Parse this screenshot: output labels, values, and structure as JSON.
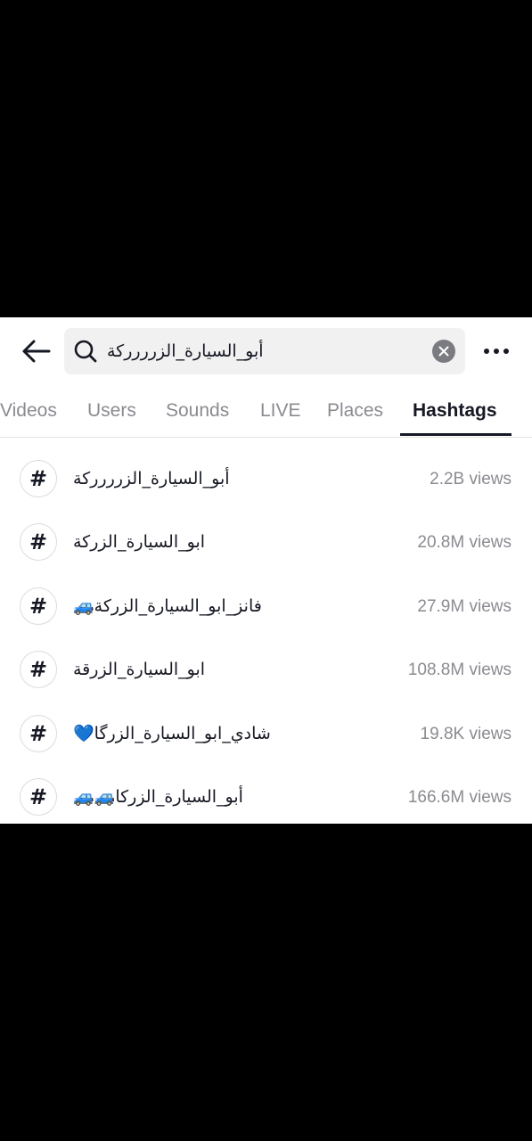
{
  "search": {
    "query": "أبو_السيارة_الزرررركة"
  },
  "tabs": [
    {
      "label": "Videos"
    },
    {
      "label": "Users"
    },
    {
      "label": "Sounds"
    },
    {
      "label": "LIVE"
    },
    {
      "label": "Places"
    },
    {
      "label": "Hashtags",
      "active": true
    }
  ],
  "hashtags": [
    {
      "name": "أبو_السيارة_الزرررركة",
      "views": "2.2B views"
    },
    {
      "name": "ابو_السيارة_الزركة",
      "views": "20.8M views"
    },
    {
      "name": "فانز_ابو_السيارة_الزركة🚙",
      "views": "27.9M views"
    },
    {
      "name": "ابو_السيارة_الزرقة",
      "views": "108.8M views"
    },
    {
      "name": "شادي_ابو_السيارة_الزرگا💙",
      "views": "19.8K views"
    },
    {
      "name": "أبو_السيارة_الزركا🚙🚙",
      "views": "166.6M views"
    }
  ],
  "hash_symbol": "#",
  "icons": {
    "back": "arrow-left-icon",
    "search": "search-icon",
    "clear": "close-circle-icon",
    "more": "more-dots-icon"
  },
  "colors": {
    "text": "#161823",
    "muted": "#8a8b91",
    "search_bg": "#f1f1f2"
  }
}
